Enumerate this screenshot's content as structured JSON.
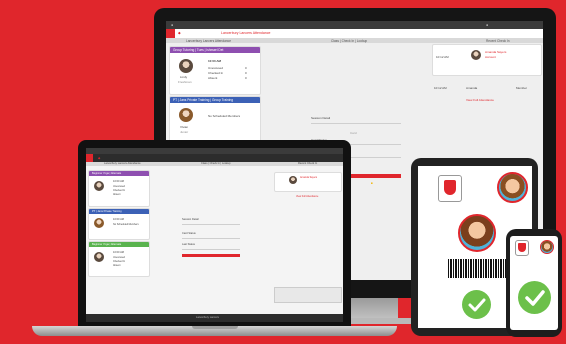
{
  "brand_color": "#e0262c",
  "monitor": {
    "app_title": "Lancerbury Lancers Attendance",
    "classes_header": "Class | Check In | Lookup",
    "recent_header": "Recent Check In",
    "cards": [
      {
        "title": "Group Tutoring | Tues | Ishmael Det",
        "color": "#8e4fb0",
        "time": "10:00 AM",
        "student": "Lindy",
        "sub": "Freshman",
        "options": [
          "Unexcused",
          "Checked In",
          "Absent"
        ],
        "counts": [
          "0",
          "0",
          "0"
        ]
      },
      {
        "title": "PT | Jans Private Training | Group Training",
        "color": "#3c61b6",
        "student": "Vivian",
        "sub": "Junior",
        "note": "No Scheduled Members"
      },
      {
        "title": "10:00 AM - 11:00 AM Beginner Yoga",
        "color": "#59b34e"
      }
    ],
    "form": {
      "label1": "Session Detail",
      "label2": "Card Status",
      "label3": "Last Status",
      "placeholder": "Card"
    },
    "recent": {
      "time": "10:12 AM",
      "name": "Amanda Sayers",
      "link1": "Account",
      "row_time": "10:12 AM",
      "row_label": "Amanda",
      "row_status": "Member",
      "view_all": "View Full Attendance"
    }
  },
  "laptop": {
    "app_title": "Lancerbury Lancers Attendance",
    "center_header": "Class | Check In | Lookup",
    "recent_header": "Recent Check In",
    "cards": [
      {
        "title": "Beginner Yoga | Alternate",
        "color": "#8e4fb0",
        "time": "10:00 AM",
        "options": [
          "Unexcused",
          "Checked In",
          "Absent"
        ]
      },
      {
        "title": "PT | Jans Private Training",
        "color": "#3c61b6",
        "time": "10:00 AM",
        "note": "No Scheduled Members"
      },
      {
        "title": "Beginner Yoga | Alternate",
        "color": "#59b34e",
        "time": "10:00 AM",
        "options": [
          "Unexcused",
          "Checked In",
          "Absent"
        ]
      }
    ],
    "form": {
      "label1": "Session Detail",
      "label2": "Card Status",
      "label3": "Last Status"
    },
    "recent": {
      "name": "Amanda Sayers",
      "view_all": "View Full Attendance"
    },
    "footer": "Lancerbury Lancers"
  }
}
